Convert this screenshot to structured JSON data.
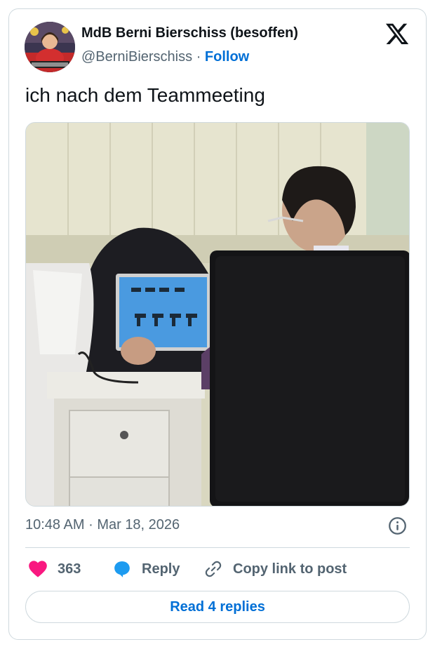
{
  "author": {
    "display_name": "MdB Berni Bierschiss (besoffen)",
    "handle": "@BerniBierschiss",
    "separator": "·",
    "follow_label": "Follow"
  },
  "tweet": {
    "text": "ich nach dem Teammeeting"
  },
  "meta": {
    "time": "10:48 AM",
    "separator": "·",
    "date": "Mar 18, 2026"
  },
  "actions": {
    "like_count": "363",
    "reply_label": "Reply",
    "copy_label": "Copy link to post"
  },
  "read_replies_label": "Read 4 replies",
  "icons": {
    "logo": "x-logo-icon",
    "info": "info-icon",
    "like": "heart-icon",
    "reply": "reply-bubble-icon",
    "copy": "link-icon"
  },
  "colors": {
    "link_blue": "#006fd6",
    "like_pink": "#f91880",
    "reply_blue": "#1d9bf0",
    "muted": "#536471",
    "border": "#cfd9de"
  }
}
